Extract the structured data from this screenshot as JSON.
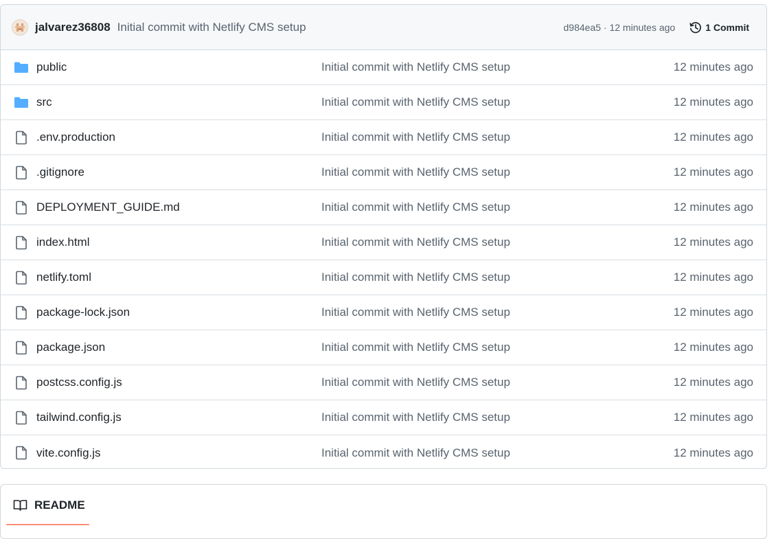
{
  "commit": {
    "author": "jalvarez36808",
    "message": "Initial commit with Netlify CMS setup",
    "sha_time": "d984ea5 · 12 minutes ago",
    "count_label": "1 Commit",
    "avatar_icon": "identicon-avatar",
    "history_icon": "history-icon"
  },
  "files": [
    {
      "name": "public",
      "type": "folder",
      "message": "Initial commit with Netlify CMS setup",
      "time": "12 minutes ago"
    },
    {
      "name": "src",
      "type": "folder",
      "message": "Initial commit with Netlify CMS setup",
      "time": "12 minutes ago"
    },
    {
      "name": ".env.production",
      "type": "file",
      "message": "Initial commit with Netlify CMS setup",
      "time": "12 minutes ago"
    },
    {
      "name": ".gitignore",
      "type": "file",
      "message": "Initial commit with Netlify CMS setup",
      "time": "12 minutes ago"
    },
    {
      "name": "DEPLOYMENT_GUIDE.md",
      "type": "file",
      "message": "Initial commit with Netlify CMS setup",
      "time": "12 minutes ago"
    },
    {
      "name": "index.html",
      "type": "file",
      "message": "Initial commit with Netlify CMS setup",
      "time": "12 minutes ago"
    },
    {
      "name": "netlify.toml",
      "type": "file",
      "message": "Initial commit with Netlify CMS setup",
      "time": "12 minutes ago"
    },
    {
      "name": "package-lock.json",
      "type": "file",
      "message": "Initial commit with Netlify CMS setup",
      "time": "12 minutes ago"
    },
    {
      "name": "package.json",
      "type": "file",
      "message": "Initial commit with Netlify CMS setup",
      "time": "12 minutes ago"
    },
    {
      "name": "postcss.config.js",
      "type": "file",
      "message": "Initial commit with Netlify CMS setup",
      "time": "12 minutes ago"
    },
    {
      "name": "tailwind.config.js",
      "type": "file",
      "message": "Initial commit with Netlify CMS setup",
      "time": "12 minutes ago"
    },
    {
      "name": "vite.config.js",
      "type": "file",
      "message": "Initial commit with Netlify CMS setup",
      "time": "12 minutes ago"
    }
  ],
  "readme": {
    "label": "README",
    "icon": "book-icon"
  },
  "colors": {
    "folder": "#54aeff",
    "file_icon": "#59636e",
    "muted_text": "#59636e",
    "tab_underline": "#fd8c73",
    "header_bg": "#f6f8fa",
    "border": "#d0d7de"
  }
}
